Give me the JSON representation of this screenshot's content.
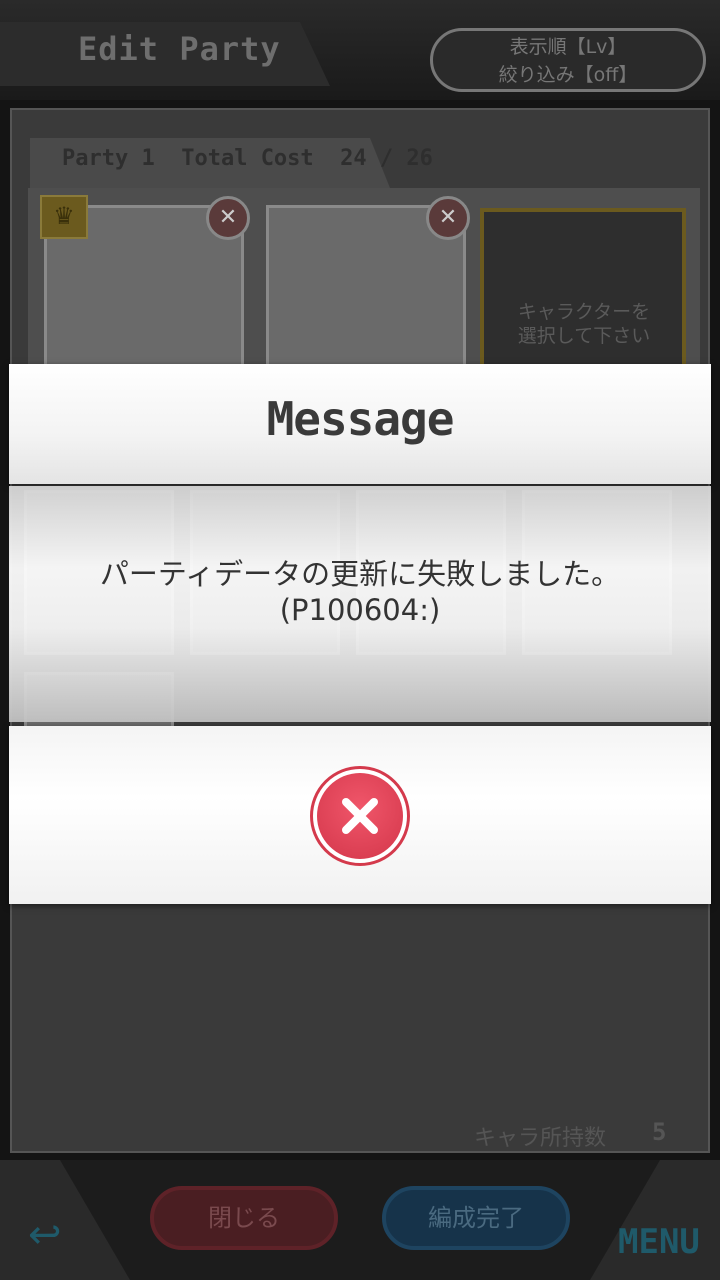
{
  "header": {
    "title": "Edit Party",
    "sort_line1": "表示順【Lv】",
    "sort_line2": "絞り込み【off】"
  },
  "party": {
    "name": "Party 1",
    "cost_label": "Total Cost",
    "cost_value": "24 / 26",
    "empty_slot_line1": "キャラクターを",
    "empty_slot_line2": "選択して下さい"
  },
  "footer": {
    "owned_label": "キャラ所持数",
    "owned_count": "5",
    "close_label": "閉じる",
    "done_label": "編成完了",
    "menu_label": "MENU"
  },
  "dialog": {
    "title": "Message",
    "message_line1": "パーティデータの更新に失敗しました。",
    "message_line2": "(P100604:)",
    "close_icon": "close-icon"
  },
  "colors": {
    "accent_red": "#E0475B",
    "dialog_bg": "#FFFFFF",
    "overlay": "#141414"
  }
}
